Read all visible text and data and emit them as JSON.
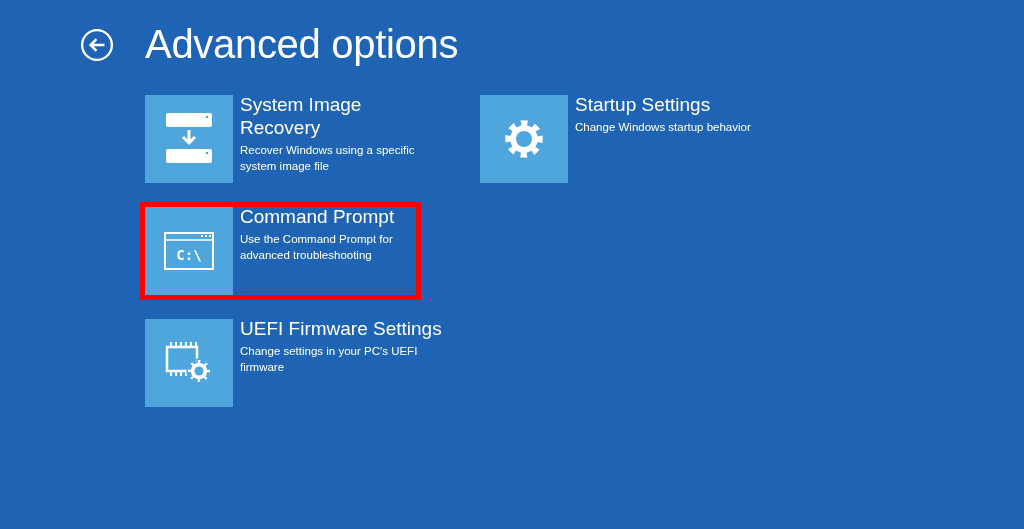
{
  "header": {
    "title": "Advanced options"
  },
  "columns": [
    [
      {
        "kind": "recovery",
        "title": "System Image Recovery",
        "description": "Recover Windows using a specific system image file",
        "highlighted": false
      },
      {
        "kind": "command",
        "icon_text": "C:\\",
        "title": "Command Prompt",
        "description": "Use the Command Prompt for advanced troubleshooting",
        "highlighted": true
      },
      {
        "kind": "firmware",
        "title": "UEFI Firmware Settings",
        "description": "Change settings in your PC's UEFI firmware",
        "highlighted": false
      }
    ],
    [
      {
        "kind": "settings",
        "title": "Startup Settings",
        "description": "Change Windows startup behavior",
        "highlighted": false
      }
    ]
  ]
}
